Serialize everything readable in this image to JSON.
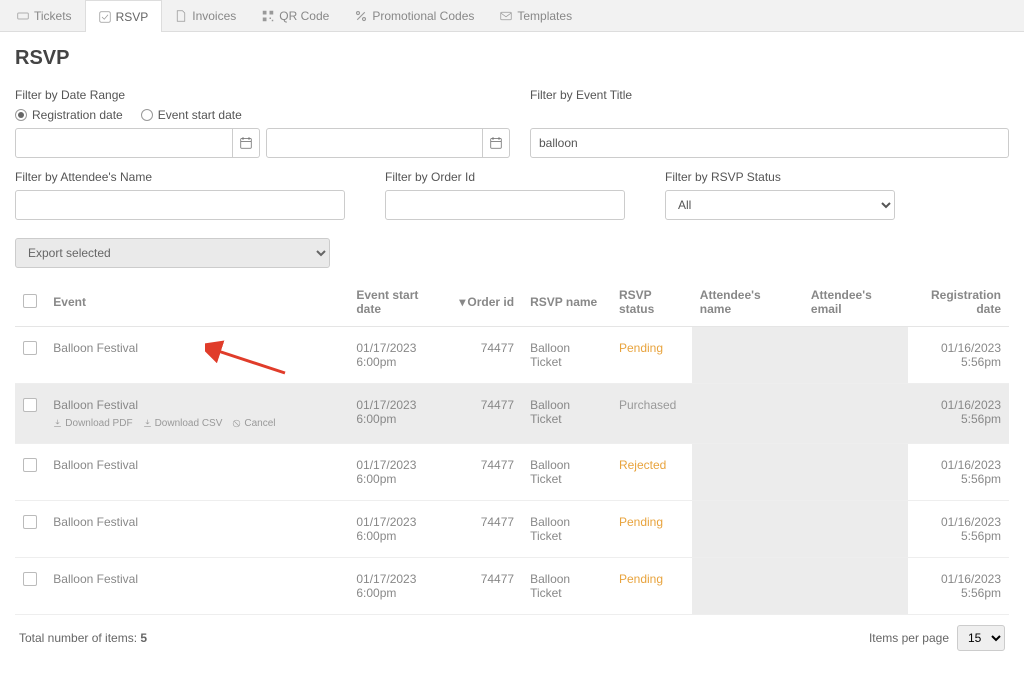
{
  "tabs": [
    {
      "label": "Tickets",
      "icon": "ticket"
    },
    {
      "label": "RSVP",
      "icon": "check-square",
      "active": true
    },
    {
      "label": "Invoices",
      "icon": "file"
    },
    {
      "label": "QR Code",
      "icon": "qr"
    },
    {
      "label": "Promotional Codes",
      "icon": "percent"
    },
    {
      "label": "Templates",
      "icon": "mail"
    }
  ],
  "page_title": "RSVP",
  "filters": {
    "date_range_label": "Filter by Date Range",
    "radio_registration": "Registration date",
    "radio_event_start": "Event start date",
    "radio_selected": "registration",
    "date_from": "",
    "date_to": "",
    "event_title_label": "Filter by Event Title",
    "event_title_value": "balloon",
    "attendee_name_label": "Filter by Attendee's Name",
    "attendee_name_value": "",
    "order_id_label": "Filter by Order Id",
    "order_id_value": "",
    "rsvp_status_label": "Filter by RSVP Status",
    "rsvp_status_value": "All"
  },
  "export_select": "Export selected",
  "columns": {
    "event": "Event",
    "start": "Event start date",
    "order": "Order id",
    "rsvp": "RSVP name",
    "status": "RSVP status",
    "aname": "Attendee's name",
    "aemail": "Attendee's email",
    "reg": "Registration date"
  },
  "rows": [
    {
      "event": "Balloon Festival",
      "start": "01/17/2023 6:00pm",
      "order": "74477",
      "rsvp": "Balloon Ticket",
      "status": "Pending",
      "status_class": "status-pending",
      "reg": "01/16/2023 5:56pm",
      "highlight": false,
      "actions": false
    },
    {
      "event": "Balloon Festival",
      "start": "01/17/2023 6:00pm",
      "order": "74477",
      "rsvp": "Balloon Ticket",
      "status": "Purchased",
      "status_class": "status-purchased",
      "reg": "01/16/2023 5:56pm",
      "highlight": true,
      "actions": true
    },
    {
      "event": "Balloon Festival",
      "start": "01/17/2023 6:00pm",
      "order": "74477",
      "rsvp": "Balloon Ticket",
      "status": "Rejected",
      "status_class": "status-rejected",
      "reg": "01/16/2023 5:56pm",
      "highlight": false,
      "actions": false
    },
    {
      "event": "Balloon Festival",
      "start": "01/17/2023 6:00pm",
      "order": "74477",
      "rsvp": "Balloon Ticket",
      "status": "Pending",
      "status_class": "status-pending",
      "reg": "01/16/2023 5:56pm",
      "highlight": false,
      "actions": false
    },
    {
      "event": "Balloon Festival",
      "start": "01/17/2023 6:00pm",
      "order": "74477",
      "rsvp": "Balloon Ticket",
      "status": "Pending",
      "status_class": "status-pending",
      "reg": "01/16/2023 5:56pm",
      "highlight": false,
      "actions": false
    }
  ],
  "row_actions": {
    "download_pdf": "Download PDF",
    "download_csv": "Download CSV",
    "cancel": "Cancel"
  },
  "footer": {
    "total_label": "Total number of items:",
    "total_value": "5",
    "per_page_label": "Items per page",
    "per_page_value": "15"
  }
}
